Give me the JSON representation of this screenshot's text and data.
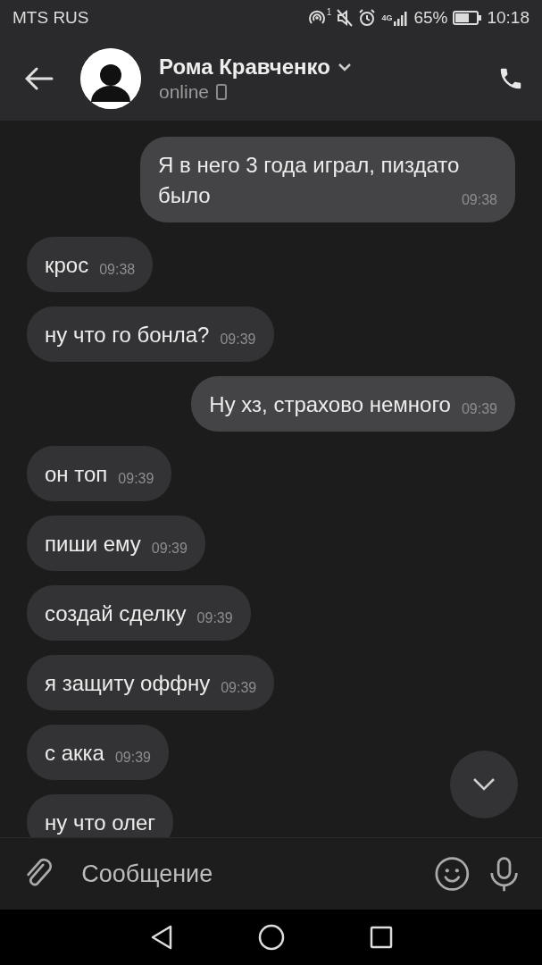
{
  "status_bar": {
    "carrier": "MTS RUS",
    "hotspot_count": "1",
    "network": "4G",
    "battery": "65%",
    "time": "10:18"
  },
  "header": {
    "name": "Рома Кравченко",
    "status": "online"
  },
  "messages": [
    {
      "outgoing": true,
      "text": "Я в него 3 года играл, пиздато было",
      "time": "09:38"
    },
    {
      "outgoing": false,
      "text": "крос",
      "time": "09:38"
    },
    {
      "outgoing": false,
      "text": "ну что го бонла?",
      "time": "09:39"
    },
    {
      "outgoing": true,
      "text": "Ну хз, страхово немного",
      "time": "09:39"
    },
    {
      "outgoing": false,
      "text": "он топ",
      "time": "09:39"
    },
    {
      "outgoing": false,
      "text": "пиши ему",
      "time": "09:39"
    },
    {
      "outgoing": false,
      "text": "создай сделку",
      "time": "09:39"
    },
    {
      "outgoing": false,
      "text": "я защиту оффну",
      "time": "09:39"
    },
    {
      "outgoing": false,
      "text": "с акка",
      "time": "09:39"
    },
    {
      "outgoing": false,
      "text": "ну что олег"
    }
  ],
  "composer": {
    "placeholder": "Сообщение"
  }
}
